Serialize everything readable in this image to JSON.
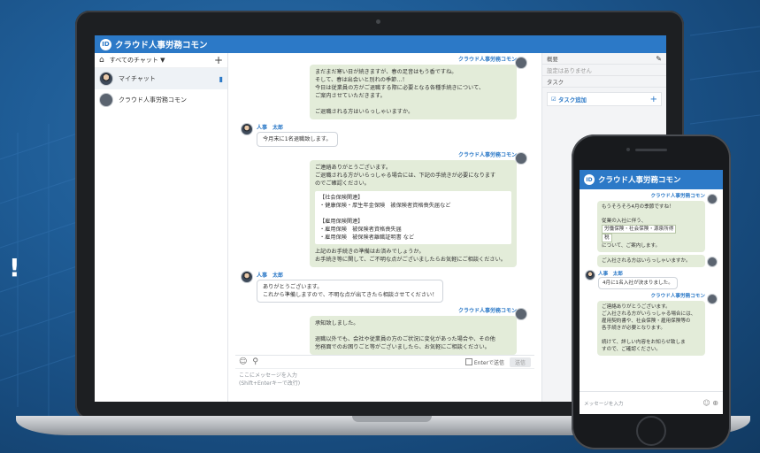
{
  "background": {
    "exclaim": "!",
    "colors": {
      "bg": "#1f5d97",
      "brand": "#2c79c7",
      "bubble": "#e3ecd9"
    }
  },
  "app": {
    "logo_text": "ID",
    "title": "クラウド人事労務コモン"
  },
  "sidebar": {
    "filter_label": "すべてのチャット ▼",
    "add_label": "+",
    "items": [
      {
        "label": "マイチャット",
        "active": true
      },
      {
        "label": "クラウド人事労務コモン"
      }
    ]
  },
  "chat": {
    "messages": [
      {
        "side": "right",
        "sender": "クラウド人事労務コモン",
        "lines": [
          "まだまだ寒い日が続きますが、春の足音はもう香ですね。",
          "そして、春は出会いと別れの季節…！",
          "今日は従業員の方がご退職する際に必要となる各種手続きについて、",
          "ご案内させていただきます。",
          "",
          "ご退職される方はいらっしゃいますか。"
        ]
      },
      {
        "side": "left",
        "sender": "人事　太郎",
        "text": "今月末に1名退職致します。"
      },
      {
        "side": "right",
        "sender": "クラウド人事労務コモン",
        "lines": [
          "ご連絡ありがとうございます。",
          "ご退職される方がいらっしゃる場合には、下記の手続きが必要になります",
          "のでご確認ください。"
        ],
        "box": [
          "【社会保険関連】",
          "・健康保険・厚生年金保険　被保険者資格喪失届など",
          "",
          "【雇用保険関連】",
          "・雇用保険　被保険者資格喪失届",
          "・雇用保険　被保険者離職証明書 など"
        ],
        "after": [
          "上記のお手続きの準備はお済みでしょうか。",
          "お手続き等に関して、ご不明な点がございましたらお気軽にご相談ください。"
        ]
      },
      {
        "side": "left",
        "sender": "人事　太郎",
        "lines": [
          "ありがとうございます。",
          "これから準備しますので、不明な点が出てきたら相談させてください！"
        ]
      },
      {
        "side": "right",
        "sender": "クラウド人事労務コモン",
        "lines": [
          "承知致しました。",
          "",
          "退職以外でも、会社や従業員の方のご状況に変化があった場合や、その他",
          "労務面でのお困りごと等がございましたら、お気軽にご相談ください。"
        ]
      }
    ],
    "composer": {
      "emoji_icon": "☺",
      "attach_icon": "⚲",
      "enter_label": "Enterで送信",
      "send_label": "送信",
      "placeholder_line1": "ここにメッセージを入力",
      "placeholder_line2": "(Shift+Enterキーで改行)"
    }
  },
  "right_panel": {
    "summary_label": "概要",
    "summary_empty": "設定はありません",
    "task_label": "タスク",
    "task_add_label": "タスク追加",
    "task_add_plus": "+"
  },
  "phone": {
    "title": "クラウド人事労務コモン",
    "m1_sender": "クラウド人事労務コモン",
    "m1_line1": "もうそろそろ4月の季節ですね！",
    "m1_line2": "",
    "m1_line3": "従業の入社に伴う、",
    "m1_hl1": "労働保険・社会保険・源泉所得",
    "m1_hl2": "税",
    "m1_line4": "について、ご案内します。",
    "m2_sender": "クラウド人事労務コモン",
    "m2_text": "ご入社される方はいらっしゃいますか。",
    "m3_sender": "人事　太郎",
    "m3_text": "4月に1名入社が決まりました。",
    "m4_sender": "クラウド人事労務コモン",
    "m4_lines": [
      "ご連絡ありがとうございます。",
      "ご入社される方がいらっしゃる場合には、",
      "雇用契約書や、社会保険・雇用保険等の",
      "各手続きが必要となります。",
      "",
      "続けて、詳しい内容をお知らせ致しま",
      "すので、ご確認ください。"
    ],
    "input_placeholder": "メッセージを入力",
    "input_icons": "☺ ⊕"
  }
}
